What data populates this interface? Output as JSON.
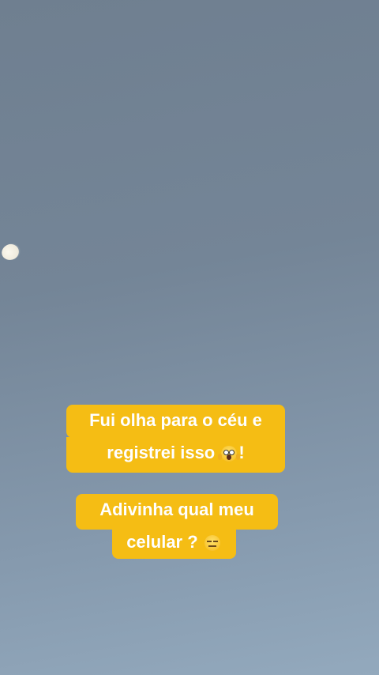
{
  "scene": {
    "description_colors": {
      "sky": "#748597",
      "caption_bg": "#f5bd14",
      "caption_text": "#ffffff"
    }
  },
  "caption": {
    "line1": "Fui olha para o céu e",
    "line2_text": "registrei isso",
    "line2_emoji": "face-screaming-in-fear-icon",
    "line2_end": "!",
    "line3": "Adivinha qual meu",
    "line4_text": "celular ?",
    "line4_emoji": "expressionless-face-icon"
  }
}
